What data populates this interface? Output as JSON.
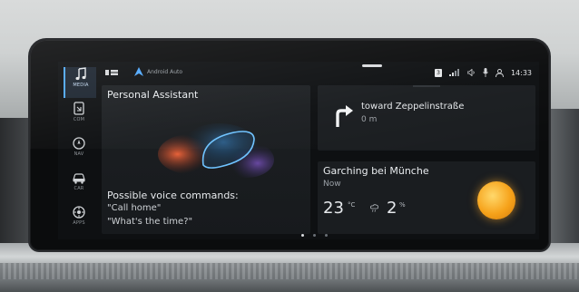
{
  "sidebar": {
    "items": [
      {
        "label": "MEDIA",
        "icon": "music-note-icon",
        "active": true
      },
      {
        "label": "COM",
        "icon": "phone-icon",
        "active": false
      },
      {
        "label": "NAV",
        "icon": "compass-icon",
        "active": false
      },
      {
        "label": "CAR",
        "icon": "car-icon",
        "active": false
      },
      {
        "label": "APPS",
        "icon": "apps-icon",
        "active": false
      }
    ]
  },
  "status_bar": {
    "app_label": "Android Auto",
    "badge": "3",
    "time": "14:33"
  },
  "assistant": {
    "title": "Personal Assistant",
    "commands_heading": "Possible voice commands:",
    "commands": [
      "\"Call home\"",
      "\"What's the time?\""
    ]
  },
  "navigation": {
    "direction": "toward Zeppelinstraße",
    "distance": "0 m",
    "maneuver_icon": "turn-right-arrow-icon"
  },
  "weather": {
    "city": "Garching bei Münche",
    "when": "Now",
    "temperature": "23",
    "temperature_unit": "°C",
    "rain_chance": "2",
    "rain_unit": "%",
    "condition_icon": "sun-icon"
  },
  "pager": {
    "total": 3,
    "active_index": 0
  },
  "colors": {
    "accent": "#4fa8ff",
    "sun": "#f6a21a",
    "card": "#1a1d20"
  }
}
